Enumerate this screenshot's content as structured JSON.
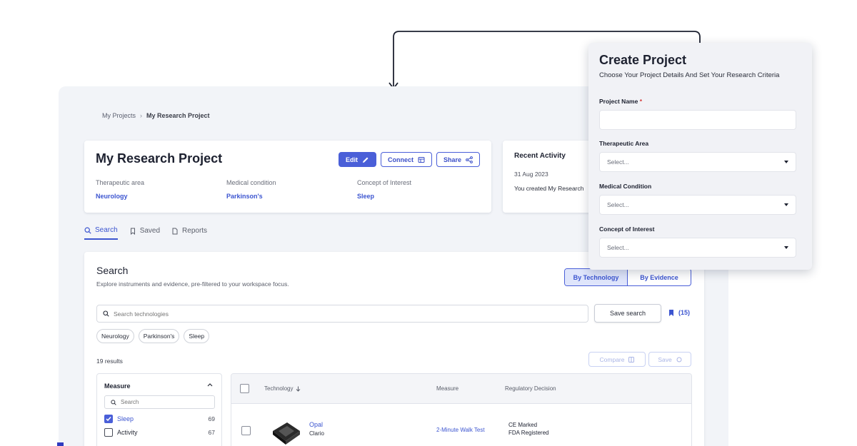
{
  "breadcrumb": {
    "parent": "My Projects",
    "separator": "›",
    "current": "My Research Project"
  },
  "project": {
    "title": "My Research Project",
    "buttons": {
      "edit": "Edit",
      "connect": "Connect",
      "share": "Share"
    },
    "meta": [
      {
        "label": "Therapeutic area",
        "value": "Neurology"
      },
      {
        "label": "Medical condition",
        "value": "Parkinson's"
      },
      {
        "label": "Concept of Interest",
        "value": "Sleep"
      }
    ]
  },
  "activity": {
    "title": "Recent Activity",
    "date": "31 Aug 2023",
    "text": "You created My Research"
  },
  "tabs": [
    {
      "label": "Search",
      "icon": "search-icon",
      "active": true
    },
    {
      "label": "Saved",
      "icon": "bookmark-icon",
      "active": false
    },
    {
      "label": "Reports",
      "icon": "document-icon",
      "active": false
    }
  ],
  "search": {
    "title": "Search",
    "subtitle": "Explore instruments and evidence, pre-filtered to your workspace focus.",
    "toggle": {
      "by_technology": "By Technology",
      "by_evidence": "By Evidence"
    },
    "placeholder": "Search technologies",
    "save_label": "Save search",
    "saved_count": "(15)",
    "chips": [
      "Neurology",
      "Parkinson's",
      "Sleep"
    ],
    "results": "19 results",
    "compare_label": "Compare",
    "save_btn_label": "Save"
  },
  "filter": {
    "title": "Measure",
    "placeholder": "Search",
    "items": [
      {
        "label": "Sleep",
        "count": "69",
        "checked": true
      },
      {
        "label": "Activity",
        "count": "67",
        "checked": false
      }
    ]
  },
  "table": {
    "columns": {
      "technology": "Technology",
      "measure": "Measure",
      "regulatory": "Regulatory Decision"
    },
    "rows": [
      {
        "name": "Opal",
        "maker": "Clario",
        "measure": "2-Minute Walk Test",
        "reg1": "CE Marked",
        "reg2": "FDA Registered"
      }
    ]
  },
  "dialog": {
    "title": "Create Project",
    "subtitle": "Choose Your Project Details And Set Your Research Criteria",
    "project_name_label": "Project Name",
    "required_mark": "*",
    "therapeutic_label": "Therapeutic Area",
    "medical_label": "Medical Condition",
    "concept_label": "Concept of Interest",
    "select_placeholder": "Select..."
  },
  "colors": {
    "accent": "#4a5fd8",
    "link": "#3c55d0",
    "required": "#d43a3a"
  }
}
